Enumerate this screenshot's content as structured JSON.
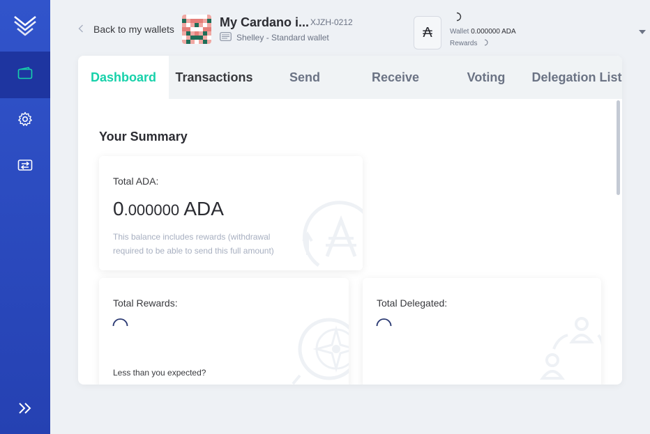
{
  "sidebar": {
    "logo_icon": "yoroi-logo-icon",
    "items": [
      {
        "name": "wallets",
        "icon": "wallet-icon",
        "active": true
      },
      {
        "name": "settings",
        "icon": "gear-icon",
        "active": false
      },
      {
        "name": "transfer",
        "icon": "transfer-icon",
        "active": false
      }
    ],
    "expand_icon": "double-chevron-right-icon"
  },
  "header": {
    "back_label": "Back to my wallets",
    "wallet_name": "My Cardano i...",
    "wallet_plate": "XJZH-0212",
    "wallet_type": "Shelley - Standard wallet",
    "ada_symbol": "₳",
    "wallet_label": "Wallet",
    "wallet_amount": "0.000000 ADA",
    "rewards_label": "Rewards"
  },
  "tabs": [
    {
      "label": "Dashboard",
      "active": true
    },
    {
      "label": "Transactions",
      "active": false
    },
    {
      "label": "Send",
      "active": false
    },
    {
      "label": "Receive",
      "active": false
    },
    {
      "label": "Voting",
      "active": false
    },
    {
      "label": "Delegation List",
      "active": false
    }
  ],
  "summary": {
    "title": "Your Summary",
    "total_ada_label": "Total ADA:",
    "total_ada_int": "0",
    "total_ada_frac": ".000000",
    "total_ada_unit": "ADA",
    "total_ada_note": "This balance includes rewards (withdrawal required to be able to send this full amount)",
    "total_rewards_label": "Total Rewards:",
    "less_expected": "Less than you expected?",
    "total_delegated_label": "Total Delegated:"
  },
  "colors": {
    "accent": "#17d1aa",
    "sidebar": "#3154cb",
    "sidebar_active": "#1e35a0"
  }
}
